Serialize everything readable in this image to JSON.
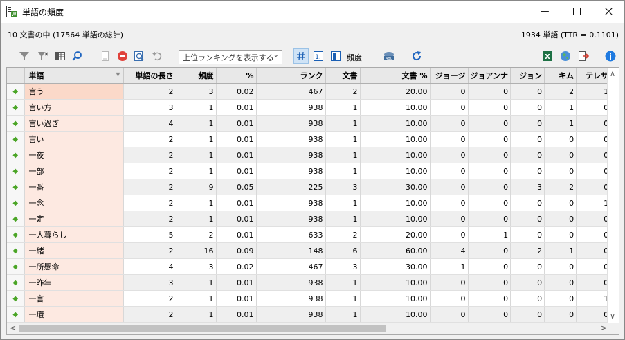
{
  "window": {
    "title": "単語の頻度"
  },
  "info": {
    "left": "10 文書の中 (17564 単語の総計)",
    "right": "1934 単語 (TTR = 0.1101)"
  },
  "toolbar": {
    "ranking_combo": "上位ランキングを表示する",
    "freq_label": "頻度",
    "icons": [
      "filter-icon",
      "clear-filter-icon",
      "columns-icon",
      "search-icon",
      "document-icon",
      "remove-icon",
      "zoom-icon",
      "undo-icon",
      "hash-icon",
      "rank-icon",
      "word-view-icon",
      "abc-icon",
      "refresh-icon",
      "excel-icon",
      "globe-icon",
      "export-icon",
      "info-icon"
    ]
  },
  "table": {
    "headers": [
      "単語",
      "単語の長さ",
      "頻度",
      "%",
      "ランク",
      "文書",
      "文書 %",
      "ジョージ",
      "ジョアンナ",
      "ジョン",
      "キム",
      "テレサ"
    ],
    "rows": [
      [
        "言う",
        "2",
        "3",
        "0.02",
        "467",
        "2",
        "20.00",
        "0",
        "0",
        "0",
        "2",
        "1"
      ],
      [
        "言い方",
        "3",
        "1",
        "0.01",
        "938",
        "1",
        "10.00",
        "0",
        "0",
        "0",
        "1",
        "0"
      ],
      [
        "言い過ぎ",
        "4",
        "1",
        "0.01",
        "938",
        "1",
        "10.00",
        "0",
        "0",
        "0",
        "1",
        "0"
      ],
      [
        "言い",
        "2",
        "1",
        "0.01",
        "938",
        "1",
        "10.00",
        "0",
        "0",
        "0",
        "0",
        "0"
      ],
      [
        "一夜",
        "2",
        "1",
        "0.01",
        "938",
        "1",
        "10.00",
        "0",
        "0",
        "0",
        "0",
        "0"
      ],
      [
        "一部",
        "2",
        "1",
        "0.01",
        "938",
        "1",
        "10.00",
        "0",
        "0",
        "0",
        "0",
        "0"
      ],
      [
        "一番",
        "2",
        "9",
        "0.05",
        "225",
        "3",
        "30.00",
        "0",
        "0",
        "3",
        "2",
        "0"
      ],
      [
        "一念",
        "2",
        "1",
        "0.01",
        "938",
        "1",
        "10.00",
        "0",
        "0",
        "0",
        "0",
        "1"
      ],
      [
        "一定",
        "2",
        "1",
        "0.01",
        "938",
        "1",
        "10.00",
        "0",
        "0",
        "0",
        "0",
        "0"
      ],
      [
        "一人暮らし",
        "5",
        "2",
        "0.01",
        "633",
        "2",
        "20.00",
        "0",
        "1",
        "0",
        "0",
        "0"
      ],
      [
        "一緒",
        "2",
        "16",
        "0.09",
        "148",
        "6",
        "60.00",
        "4",
        "0",
        "2",
        "1",
        "0"
      ],
      [
        "一所懸命",
        "4",
        "3",
        "0.02",
        "467",
        "3",
        "30.00",
        "1",
        "0",
        "0",
        "0",
        "0"
      ],
      [
        "一昨年",
        "3",
        "1",
        "0.01",
        "938",
        "1",
        "10.00",
        "0",
        "0",
        "0",
        "0",
        "0"
      ],
      [
        "一言",
        "2",
        "1",
        "0.01",
        "938",
        "1",
        "10.00",
        "0",
        "0",
        "0",
        "0",
        "1"
      ],
      [
        "一環",
        "2",
        "1",
        "0.01",
        "938",
        "1",
        "10.00",
        "0",
        "0",
        "0",
        "0",
        "0"
      ]
    ]
  }
}
